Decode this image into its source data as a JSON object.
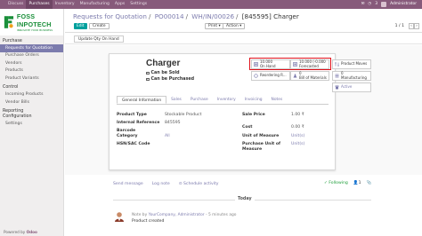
{
  "topbar": {
    "menu": [
      "Discuss",
      "Purchases",
      "Inventory",
      "Manufacturing",
      "Apps",
      "Settings"
    ],
    "active_index": 1,
    "user": "Administrator",
    "badge": "3"
  },
  "sidebar": {
    "logo_title": "FOSS INPOTECH",
    "logo_subtitle": "INNOVATE YOUR BUSINESS",
    "sections": [
      {
        "title": "Purchase",
        "items": [
          "Requests for Quotation",
          "Purchase Orders",
          "Vendors",
          "Products",
          "Product Variants"
        ]
      },
      {
        "title": "Control",
        "items": [
          "Incoming Products",
          "Vendor Bills"
        ]
      },
      {
        "title": "Reporting Configuration",
        "items": [
          "Settings"
        ]
      }
    ],
    "active_item": "Requests for Quotation",
    "powered_by": "Powered by",
    "powered_brand": "Odoo"
  },
  "control": {
    "breadcrumb": [
      "Requests for Quotation",
      "PO00014",
      "WH/IN/00026",
      "[845595] Charger"
    ],
    "edit_label": "Edit",
    "create_label": "Create",
    "print_label": "Print ▾",
    "action_label": "Action ▾",
    "pager": "1 / 1",
    "prev": "‹",
    "next": "›"
  },
  "statusbar": {
    "update_qty_label": "Update Qty On Hand"
  },
  "product": {
    "name": "Charger",
    "can_be_sold_label": "Can be Sold",
    "can_be_purchased_label": "Can be Purchased",
    "can_be_sold": true,
    "can_be_purchased": true
  },
  "smart_buttons": {
    "on_hand_value": "10.000",
    "on_hand_label": "On Hand",
    "forecasted_value": "10.000 (-0.000",
    "forecasted_label": "Forecasted",
    "product_moves_label": "Product Moves",
    "reordering_label": "Reordering R...",
    "bom_value": "0",
    "bom_label": "Bill of Materials",
    "manufacturing_value": "0",
    "manufacturing_label": "Manufacturing",
    "active_label": "Active"
  },
  "tabs": [
    "General Information",
    "Sales",
    "Purchase",
    "Inventory",
    "Invoicing",
    "Notes"
  ],
  "general": {
    "product_type_label": "Product Type",
    "product_type_value": "Stockable Product",
    "internal_ref_label": "Internal Reference",
    "internal_ref_value": "845595",
    "barcode_label": "Barcode",
    "category_label": "Category",
    "category_value": "All",
    "hsn_label": "HSN/SAC Code",
    "sale_price_label": "Sale Price",
    "sale_price_value": "1.00 ₹",
    "cost_label": "Cost",
    "cost_value": "0.00 ₹",
    "uom_label": "Unit of Measure",
    "uom_value": "Unit(s)",
    "purchase_uom_label1": "Purchase Unit of",
    "purchase_uom_label2": "Measure",
    "purchase_uom_value": "Unit(s)"
  },
  "chatter": {
    "send_message": "Send message",
    "log_note": "Log note",
    "schedule_activity": "⊙ Schedule activity",
    "following": "✓ Following",
    "followers_count": "1",
    "today": "Today",
    "note_prefix": "Note by",
    "note_author": "YourCompany, Administrator",
    "note_time": "- 5 minutes ago",
    "note_body": "Product created"
  },
  "colors": {
    "navbar": "#875a7b",
    "primary": "#00a09d",
    "link": "#7c7bad",
    "highlight_box": "#e0101a"
  }
}
